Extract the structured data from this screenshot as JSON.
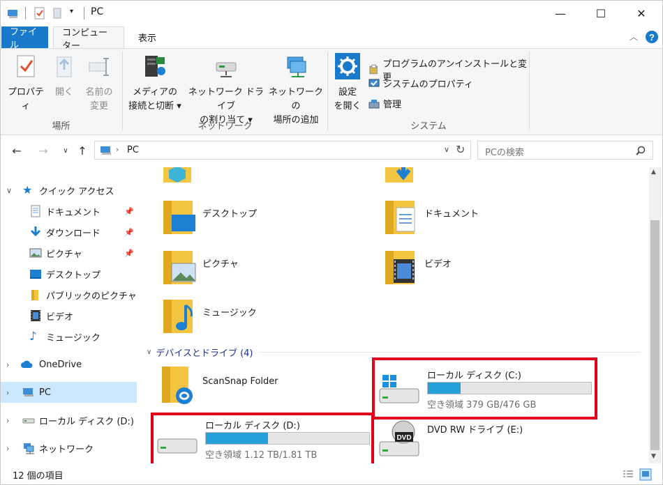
{
  "window": {
    "title": "PC",
    "minimize": "—",
    "maximize": "☐",
    "close": "✕"
  },
  "ribbon_tabs": {
    "file": "ファイル",
    "computer": "コンピューター",
    "view": "表示"
  },
  "ribbon": {
    "location_group": {
      "label": "場所",
      "properties": [
        "プロパティ"
      ],
      "open": [
        "開く"
      ],
      "rename": [
        "名前の",
        "変更"
      ]
    },
    "network_group": {
      "label": "ネットワーク",
      "media": [
        "メディアの",
        "接続と切断 ▾"
      ],
      "map_drive": [
        "ネットワーク ドライブ",
        "の割り当て ▾"
      ],
      "add_location": [
        "ネットワークの",
        "場所の追加"
      ]
    },
    "system_group": {
      "label": "システム",
      "settings": [
        "設定",
        "を開く"
      ],
      "uninstall": "プログラムのアンインストールと変更",
      "system_properties": "システムのプロパティ",
      "manage": "管理"
    }
  },
  "address": {
    "path": "PC",
    "search_placeholder": "PCの検索"
  },
  "sidebar": {
    "quick_access": "クイック アクセス",
    "items": [
      {
        "label": "ドキュメント",
        "pinned": true,
        "icon": "document-icon"
      },
      {
        "label": "ダウンロード",
        "pinned": true,
        "icon": "download-icon"
      },
      {
        "label": "ピクチャ",
        "pinned": true,
        "icon": "pictures-icon"
      },
      {
        "label": "デスクトップ",
        "pinned": false,
        "icon": "desktop-icon"
      },
      {
        "label": "パブリックのピクチャ",
        "pinned": false,
        "icon": "folder-icon"
      },
      {
        "label": "ビデオ",
        "pinned": false,
        "icon": "video-icon"
      },
      {
        "label": "ミュージック",
        "pinned": false,
        "icon": "music-icon"
      }
    ],
    "onedrive": "OneDrive",
    "pc": "PC",
    "local_d": "ローカル ディスク (D:)",
    "network": "ネットワーク"
  },
  "folders": [
    {
      "label": "デスクトップ",
      "icon": "desktop-folder-icon"
    },
    {
      "label": "ドキュメント",
      "icon": "documents-folder-icon"
    },
    {
      "label": "ピクチャ",
      "icon": "pictures-folder-icon"
    },
    {
      "label": "ビデオ",
      "icon": "videos-folder-icon"
    },
    {
      "label": "ミュージック",
      "icon": "music-folder-icon"
    }
  ],
  "devices": {
    "header": "デバイスとドライブ (4)",
    "items": [
      {
        "name": "ScanSnap Folder",
        "icon": "scansnap-icon"
      },
      {
        "name": "ローカル ディスク (C:)",
        "free": "空き領域 379 GB/476 GB",
        "used_fraction": 0.2,
        "icon": "windows-drive-icon"
      },
      {
        "name": "ローカル ディスク (D:)",
        "free": "空き領域 1.12 TB/1.81 TB",
        "used_fraction": 0.38,
        "icon": "drive-icon"
      },
      {
        "name": "DVD RW ドライブ (E:)",
        "icon": "dvd-drive-icon"
      }
    ]
  },
  "status": {
    "count": "12 個の項目"
  },
  "colors": {
    "accent": "#1979ca",
    "selection": "#cce8ff",
    "highlight": "#e0001b",
    "bar_fill": "#26a0da"
  }
}
